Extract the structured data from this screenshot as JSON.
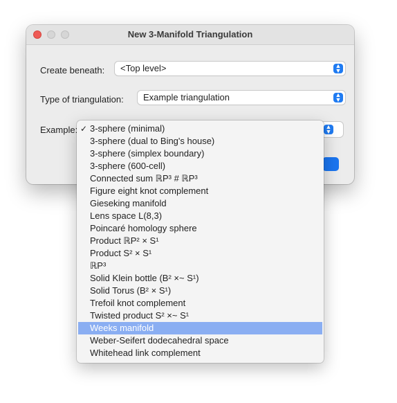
{
  "dialog": {
    "title": "New 3-Manifold Triangulation",
    "create_beneath": {
      "label": "Create beneath:",
      "value": "<Top level>"
    },
    "type": {
      "label": "Type of triangulation:",
      "value": "Example triangulation"
    },
    "example": {
      "label": "Example:"
    }
  },
  "menu": {
    "checkmark": "✓",
    "items": [
      "3-sphere (minimal)",
      "3-sphere (dual to Bing's house)",
      "3-sphere (simplex boundary)",
      "3-sphere (600-cell)",
      "Connected sum ℝP³ # ℝP³",
      "Figure eight knot complement",
      "Gieseking manifold",
      "Lens space L(8,3)",
      "Poincaré homology sphere",
      "Product ℝP² × S¹",
      "Product S² × S¹",
      "ℝP³",
      "Solid Klein bottle (B² ×~ S¹)",
      "Solid Torus (B² × S¹)",
      "Trefoil knot complement",
      "Twisted product S² ×~ S¹",
      "Weeks manifold",
      "Weber-Seifert dodecahedral space",
      "Whitehead link complement"
    ],
    "checked_index": 0,
    "highlighted_index": 16
  },
  "colors": {
    "accent": "#1f7bf2",
    "highlight": "#8aaef2",
    "close": "#ee5b56"
  },
  "icons": {
    "stepper": "up-down-chevron-icon",
    "check": "checkmark-icon"
  }
}
